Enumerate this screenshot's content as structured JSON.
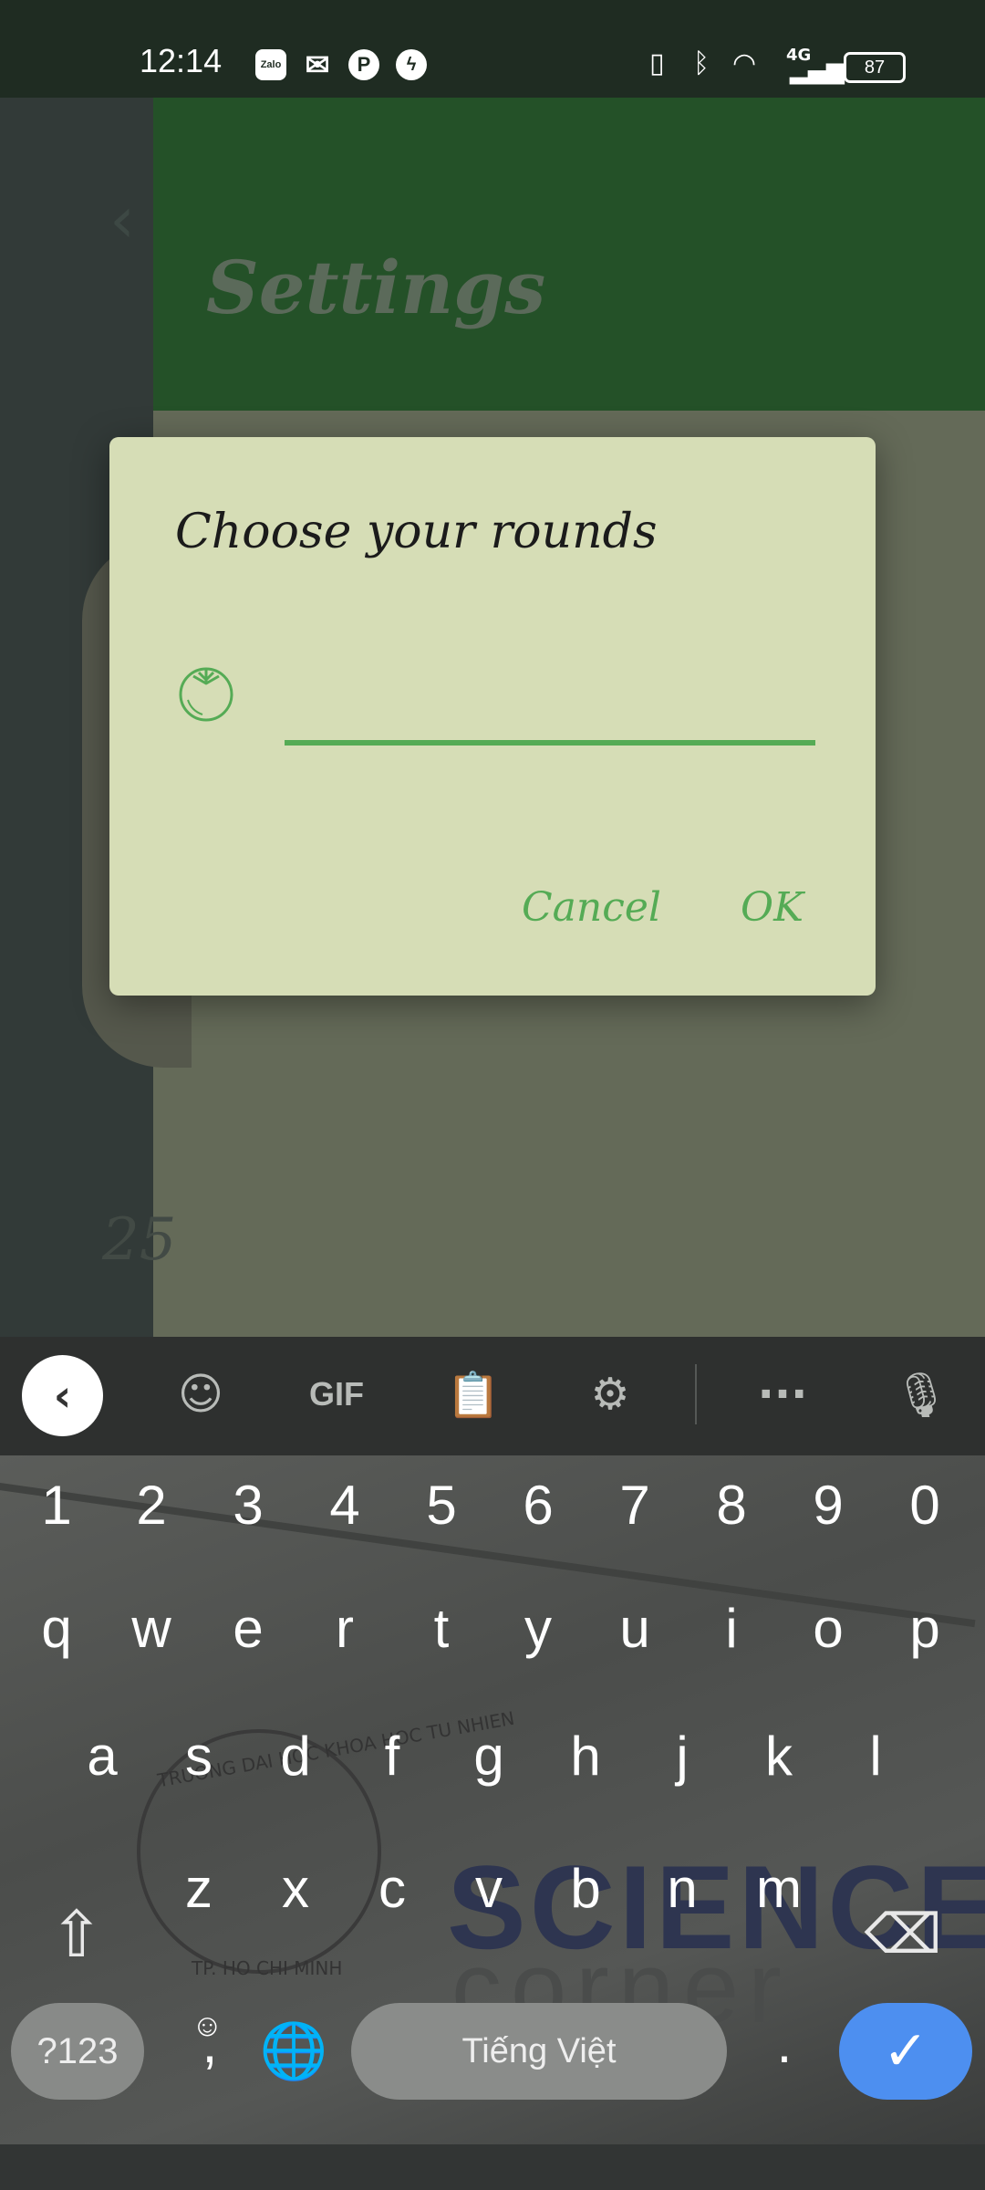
{
  "status_bar": {
    "time": "12:14",
    "notifications": [
      "Zalo",
      "mail-icon",
      "pinterest-icon",
      "messenger-icon"
    ],
    "zalo_label": "Zalo",
    "battery": "87",
    "network_label": "4G"
  },
  "app": {
    "title": "Settings",
    "background_number": "25"
  },
  "dialog": {
    "title": "Choose your rounds",
    "input_value": "",
    "cancel_label": "Cancel",
    "ok_label": "OK",
    "accent_color": "#55ab55"
  },
  "keyboard": {
    "toolbar": {
      "gif_label": "GIF"
    },
    "number_row": [
      "1",
      "2",
      "3",
      "4",
      "5",
      "6",
      "7",
      "8",
      "9",
      "0"
    ],
    "row1": [
      "q",
      "w",
      "e",
      "r",
      "t",
      "y",
      "u",
      "i",
      "o",
      "p"
    ],
    "row2": [
      "a",
      "s",
      "d",
      "f",
      "g",
      "h",
      "j",
      "k",
      "l"
    ],
    "row3": [
      "z",
      "x",
      "c",
      "v",
      "b",
      "n",
      "m"
    ],
    "symbols_label": "?123",
    "comma_label": ",",
    "emoji_label": "☺",
    "space_label": "Tiếng Việt",
    "period_label": ".",
    "background_image_text": {
      "school": "TRUONG DAI HOC KHOA HOC TU NHIEN",
      "city": "TP. HO CHI MINH",
      "word1": "SCIENCE",
      "word2": "corner"
    }
  }
}
